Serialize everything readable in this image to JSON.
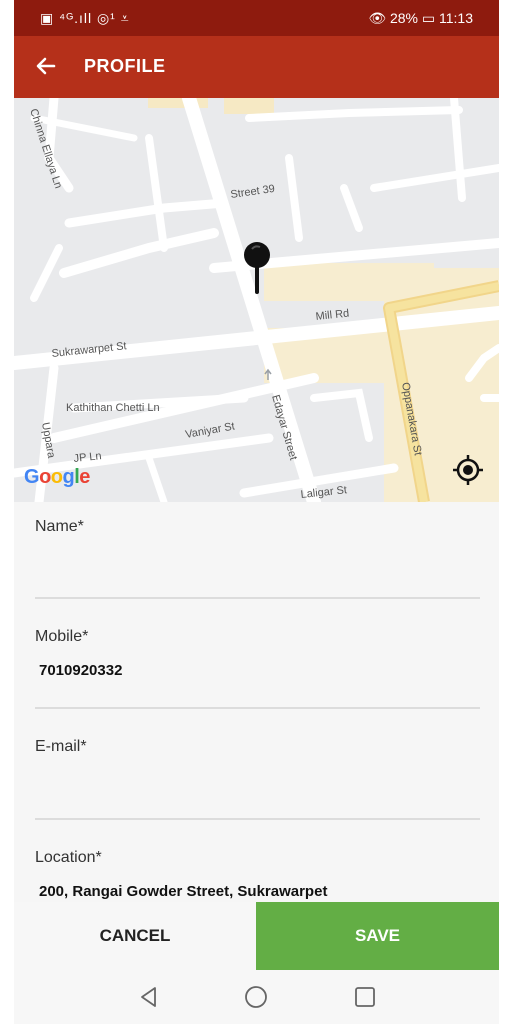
{
  "status_bar": {
    "left_icons": "▣ ⁴ᴳ.ıll ◎¹ ⩡",
    "right_text": "👁 28% ▭ 11:13"
  },
  "app_bar": {
    "title": "PROFILE",
    "back_icon": "arrow-left"
  },
  "map": {
    "streets": [
      "Chinna Ellaya Ln",
      "Street 39",
      "Mill Rd",
      "Sukrawarpet St",
      "Kathithan Chetti Ln",
      "Vaniyar St",
      "Edayar Street",
      "Oppanakara St",
      "JP Ln",
      "Uppara",
      "Laligar St"
    ],
    "attribution": "Google",
    "locate_icon": "my-location-target",
    "pin_icon": "map-pin"
  },
  "form": {
    "name": {
      "label": "Name*",
      "value": ""
    },
    "mobile": {
      "label": "Mobile*",
      "value": "7010920332"
    },
    "email": {
      "label": "E-mail*",
      "value": ""
    },
    "location": {
      "label": "Location*",
      "value": "200, Rangai Gowder Street, Sukrawarpet"
    }
  },
  "actions": {
    "cancel": "CANCEL",
    "save": "SAVE"
  },
  "colors": {
    "status": "#8e1b0e",
    "app_bar": "#b5301a",
    "save": "#63ae45"
  }
}
